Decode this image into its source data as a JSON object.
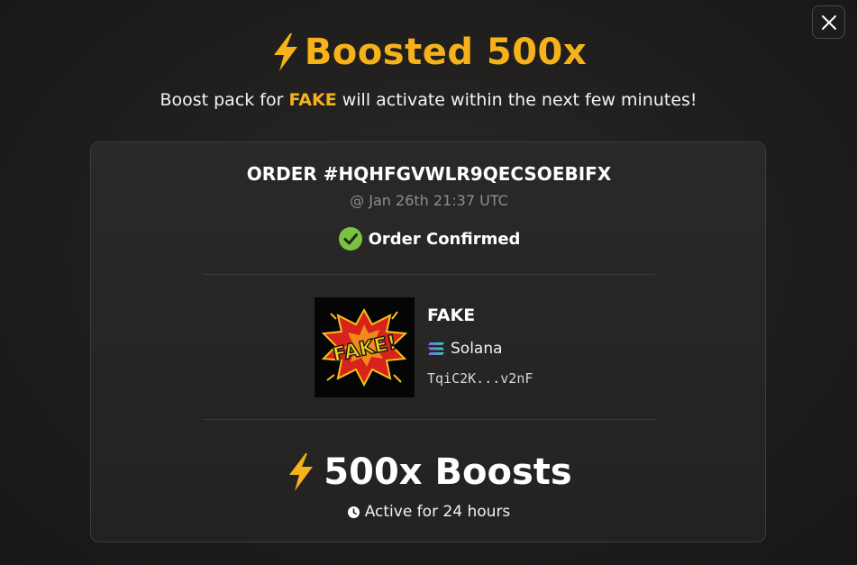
{
  "dialog": {
    "close_icon": "close-icon"
  },
  "header": {
    "icon": "lightning-bolt-icon",
    "title": "Boosted 500x",
    "subtitle_prefix": "Boost pack for ",
    "subtitle_token": "FAKE",
    "subtitle_suffix": " will activate within the next few minutes!"
  },
  "order": {
    "id_label": "ORDER #HQHFGVWLR9QECSOEBIFX",
    "timestamp": "@ Jan 26th 21:37 UTC",
    "status_icon": "check-circle-icon",
    "status": "Order Confirmed"
  },
  "token": {
    "image_icon": "fake-comic-logo-icon",
    "image_text": "FAKE!",
    "name": "FAKE",
    "chain_icon": "solana-icon",
    "chain": "Solana",
    "address": "TqiC2K...v2nF"
  },
  "boost": {
    "icon": "lightning-bolt-icon",
    "label": "500x Boosts",
    "duration_icon": "clock-icon",
    "duration": "Active for 24 hours"
  },
  "colors": {
    "accent": "#f6b21a",
    "success": "#7cc242",
    "background": "#1f1e1d",
    "card": "#262524"
  }
}
